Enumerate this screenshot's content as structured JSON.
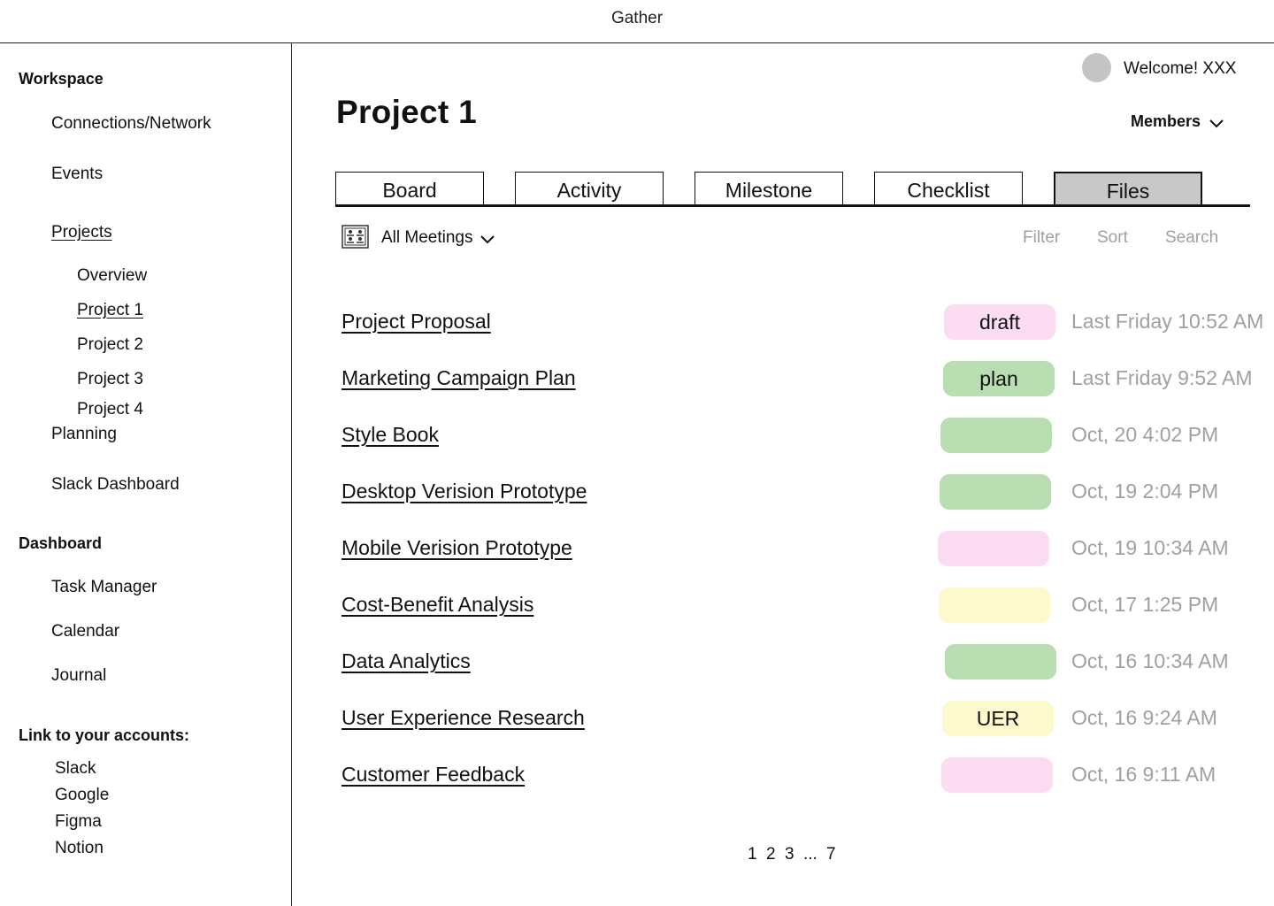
{
  "app": {
    "title": "Gather"
  },
  "sidebar": {
    "workspace_heading": "Workspace",
    "connections": "Connections/Network",
    "events": "Events",
    "projects": "Projects",
    "project_items": [
      "Overview",
      "Project 1",
      "Project 2",
      "Project 3",
      "Project 4"
    ],
    "planning": "Planning",
    "slack_dashboard": "Slack Dashboard",
    "dashboard_heading": "Dashboard",
    "dashboard_items": [
      "Task Manager",
      "Calendar",
      "Journal"
    ],
    "accounts_heading": "Link to your accounts:",
    "accounts": [
      "Slack",
      "Google",
      "Figma",
      "Notion"
    ]
  },
  "header": {
    "welcome": "Welcome! XXX",
    "page_title": "Project 1",
    "members_label": "Members"
  },
  "tabs": [
    "Board",
    "Activity",
    "Milestone",
    "Checklist",
    "Files"
  ],
  "active_tab": "Files",
  "toolbar": {
    "meetings_label": "All Meetings",
    "filter": "Filter",
    "sort": "Sort",
    "search": "Search"
  },
  "files": [
    {
      "name": "Project Proposal",
      "badge": "draft",
      "badge_color": "#fbdcf2",
      "date": "Last Friday 10:52 AM"
    },
    {
      "name": "Marketing Campaign Plan",
      "badge": "plan",
      "badge_color": "#b9deb1",
      "date": "Last Friday 9:52 AM"
    },
    {
      "name": "Style Book",
      "badge": "",
      "badge_color": "#b9deb1",
      "date": "Oct, 20 4:02 PM"
    },
    {
      "name": "Desktop Verision Prototype",
      "badge": "",
      "badge_color": "#b9deb1",
      "date": "Oct, 19 2:04 PM"
    },
    {
      "name": "Mobile Verision Prototype",
      "badge": "",
      "badge_color": "#fbdcf2",
      "date": "Oct, 19 10:34 AM"
    },
    {
      "name": "Cost-Benefit Analysis",
      "badge": "",
      "badge_color": "#fdf9cc",
      "date": "Oct, 17 1:25 PM"
    },
    {
      "name": "Data Analytics",
      "badge": "",
      "badge_color": "#b9deb1",
      "date": "Oct, 16 10:34 AM"
    },
    {
      "name": "User Experience Research",
      "badge": "UER",
      "badge_color": "#fdf9cc",
      "date": "Oct, 16 9:24 AM"
    },
    {
      "name": "Customer Feedback",
      "badge": "",
      "badge_color": "#fbdcf2",
      "date": "Oct, 16 9:11 AM"
    }
  ],
  "pagination": [
    "1",
    "2",
    "3",
    "...",
    "7"
  ]
}
